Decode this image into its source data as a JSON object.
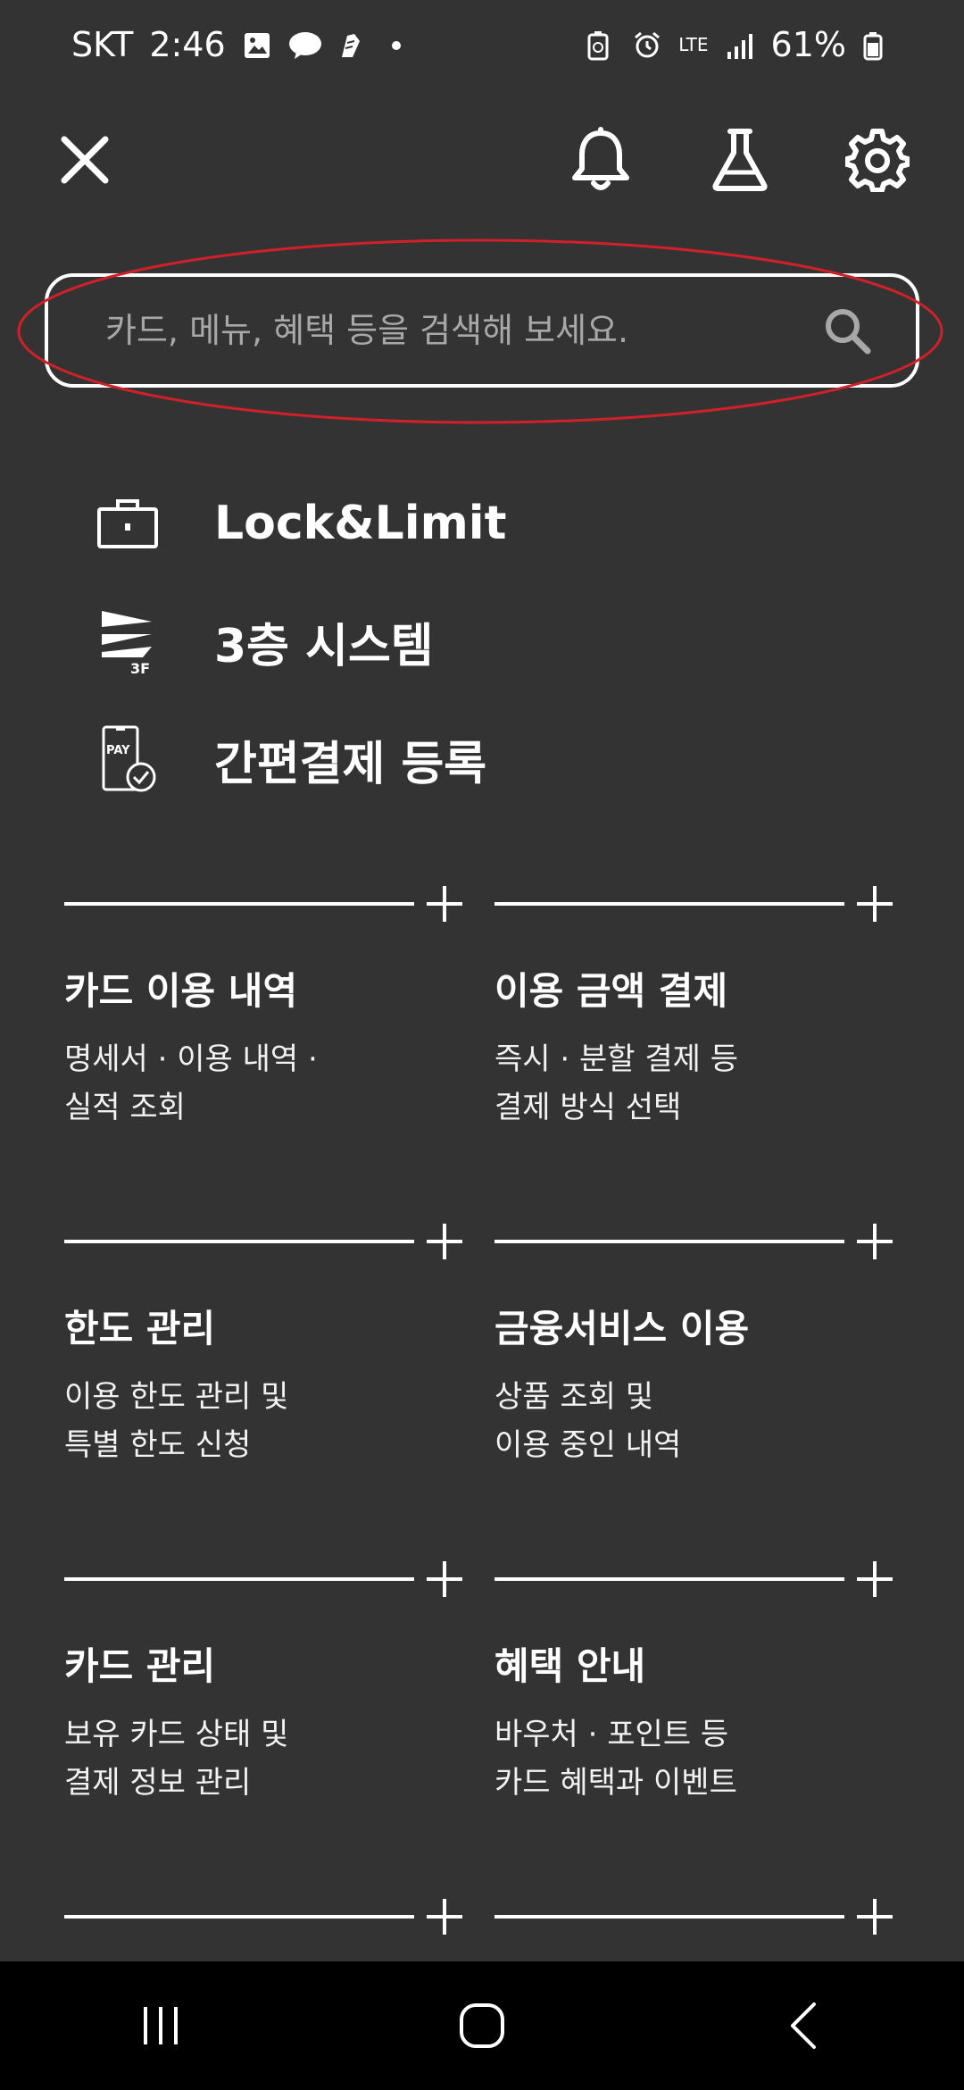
{
  "status_bar": {
    "carrier": "SKT",
    "time": "2:46",
    "network": "LTE",
    "battery": "61%"
  },
  "search": {
    "placeholder": "카드, 메뉴, 혜택 등을 검색해 보세요."
  },
  "quick_menu": [
    {
      "label": "Lock&Limit",
      "icon": "lock-briefcase-icon"
    },
    {
      "label": "3층 시스템",
      "icon": "3f-system-icon"
    },
    {
      "label": "간편결제 등록",
      "icon": "pay-register-icon"
    }
  ],
  "quick_icon_text": {
    "floor": "3F",
    "pay": "PAY"
  },
  "cards": [
    {
      "title": "카드 이용 내역",
      "desc": "명세서 · 이용 내역 ·\n실적 조회"
    },
    {
      "title": "이용 금액 결제",
      "desc": "즉시 · 분할 결제 등\n결제 방식 선택"
    },
    {
      "title": "한도 관리",
      "desc": "이용 한도 관리 및\n특별 한도 신청"
    },
    {
      "title": "금융서비스 이용",
      "desc": "상품 조회 및\n이용 중인 내역"
    },
    {
      "title": "카드 관리",
      "desc": "보유 카드 상태 및\n결제 정보 관리"
    },
    {
      "title": "혜택 안내",
      "desc": "바우처 · 포인트 등\n카드 혜택과 이벤트"
    }
  ],
  "colors": {
    "background": "#333333",
    "text": "#ffffff",
    "placeholder": "#a8a8a8",
    "highlight": "#d0202a",
    "nav_bar": "#000000"
  }
}
